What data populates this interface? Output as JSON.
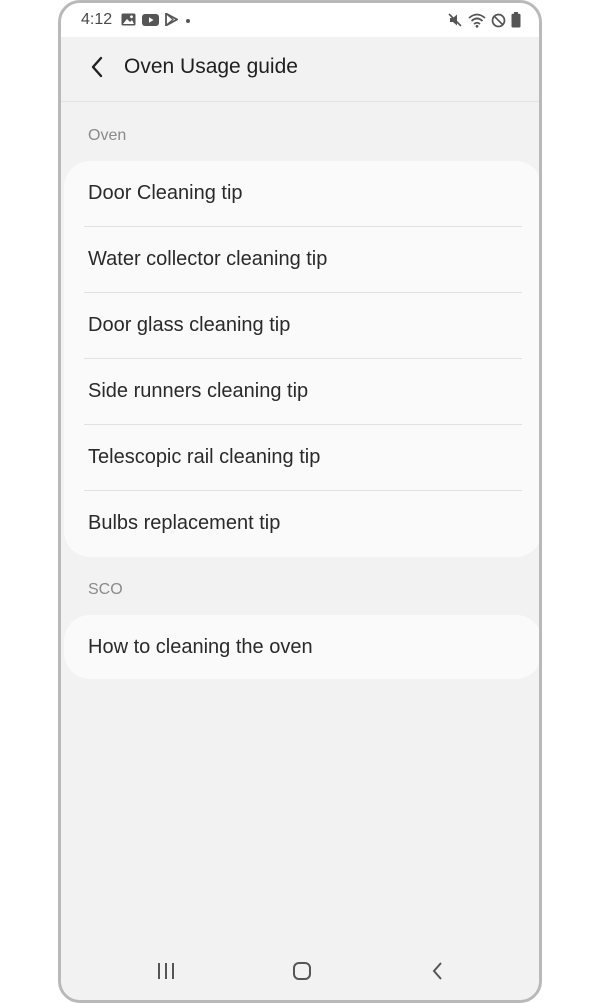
{
  "status_bar": {
    "time": "4:12",
    "left_icons": [
      "image-icon",
      "youtube-icon",
      "play-store-icon",
      "dot-icon"
    ],
    "right_icons": [
      "mute-icon",
      "wifi-icon",
      "do-not-disturb-icon",
      "battery-icon"
    ]
  },
  "header": {
    "back_icon": "chevron-left-icon",
    "title": "Oven Usage guide"
  },
  "sections": [
    {
      "label": "Oven",
      "items": [
        "Door Cleaning tip",
        "Water collector cleaning tip",
        "Door glass cleaning tip",
        "Side runners cleaning tip",
        "Telescopic rail cleaning tip",
        "Bulbs replacement tip"
      ]
    },
    {
      "label": "SCO",
      "items": [
        "How to cleaning the oven"
      ]
    }
  ],
  "nav_bar": {
    "icons": [
      "recents-icon",
      "home-icon",
      "back-icon"
    ]
  },
  "colors": {
    "background": "#f2f2f2",
    "card": "#fafafa",
    "section_label": "#8a8a8a",
    "text": "#2a2a2a"
  }
}
